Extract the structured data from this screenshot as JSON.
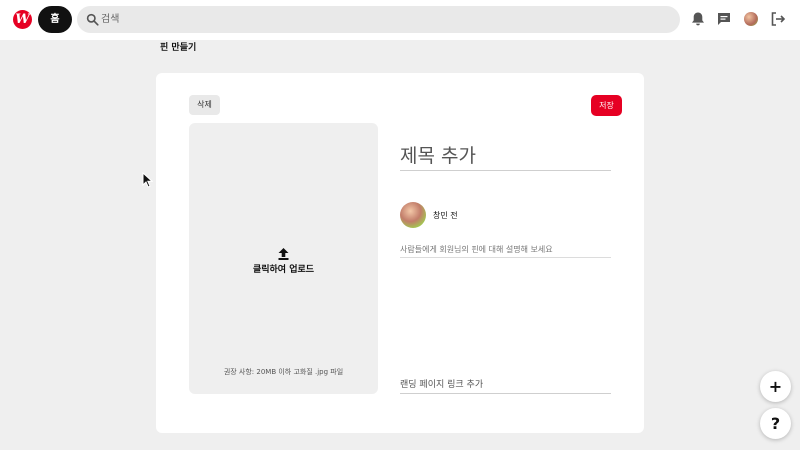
{
  "header": {
    "logo_letter": "W",
    "home_label": "홈",
    "search_placeholder": "검색"
  },
  "page": {
    "title": "핀 만들기"
  },
  "card": {
    "delete_label": "삭제",
    "save_label": "저장",
    "upload": {
      "label": "클릭하여 업로드",
      "hint": "권장 사항: 20MB 이하 고화질 .jpg 파일"
    },
    "title_placeholder": "제목 추가",
    "user_name": "창민 전",
    "description_placeholder": "사람들에게 회원님의 핀에 대해 설명해 보세요",
    "link_placeholder": "랜딩 페이지 링크 추가"
  },
  "fabs": {
    "add_label": "+",
    "help_label": "?"
  },
  "colors": {
    "brand": "#e60023",
    "background": "#efefef"
  },
  "icons": [
    "search-icon",
    "bell-icon",
    "chat-icon",
    "logout-icon",
    "upload-icon",
    "mouse-cursor-icon"
  ]
}
